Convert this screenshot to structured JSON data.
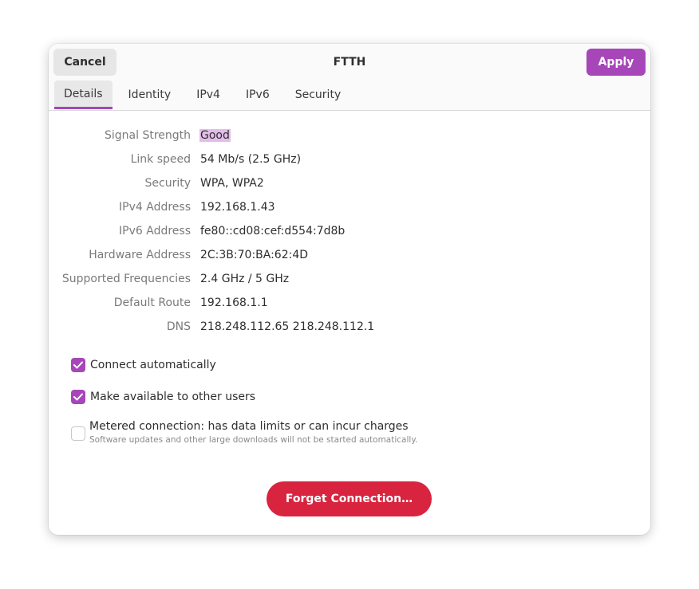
{
  "header": {
    "cancel_label": "Cancel",
    "title": "FTTH",
    "apply_label": "Apply"
  },
  "tabs": [
    {
      "label": "Details",
      "active": true
    },
    {
      "label": "Identity",
      "active": false
    },
    {
      "label": "IPv4",
      "active": false
    },
    {
      "label": "IPv6",
      "active": false
    },
    {
      "label": "Security",
      "active": false
    }
  ],
  "details": [
    {
      "label": "Signal Strength",
      "value": "Good"
    },
    {
      "label": "Link speed",
      "value": "54 Mb/s (2.5 GHz)"
    },
    {
      "label": "Security",
      "value": "WPA, WPA2"
    },
    {
      "label": "IPv4 Address",
      "value": "192.168.1.43"
    },
    {
      "label": "IPv6 Address",
      "value": "fe80::cd08:cef:d554:7d8b"
    },
    {
      "label": "Hardware Address",
      "value": "2C:3B:70:BA:62:4D"
    },
    {
      "label": "Supported Frequencies",
      "value": "2.4 GHz / 5 GHz"
    },
    {
      "label": "Default Route",
      "value": "192.168.1.1"
    },
    {
      "label": "DNS",
      "value": "218.248.112.65 218.248.112.1"
    }
  ],
  "options": {
    "connect_automatically": {
      "label": "Connect automatically",
      "checked": true
    },
    "available_to_others": {
      "label": "Make available to other users",
      "checked": true
    },
    "metered": {
      "label": "Metered connection: has data limits or can incur charges",
      "sublabel": "Software updates and other large downloads will not be started automatically.",
      "checked": false
    }
  },
  "forget_label": "Forget Connection…",
  "colors": {
    "accent": "#a646b9",
    "destructive": "#d8243f",
    "highlight": "#e3bde9"
  }
}
